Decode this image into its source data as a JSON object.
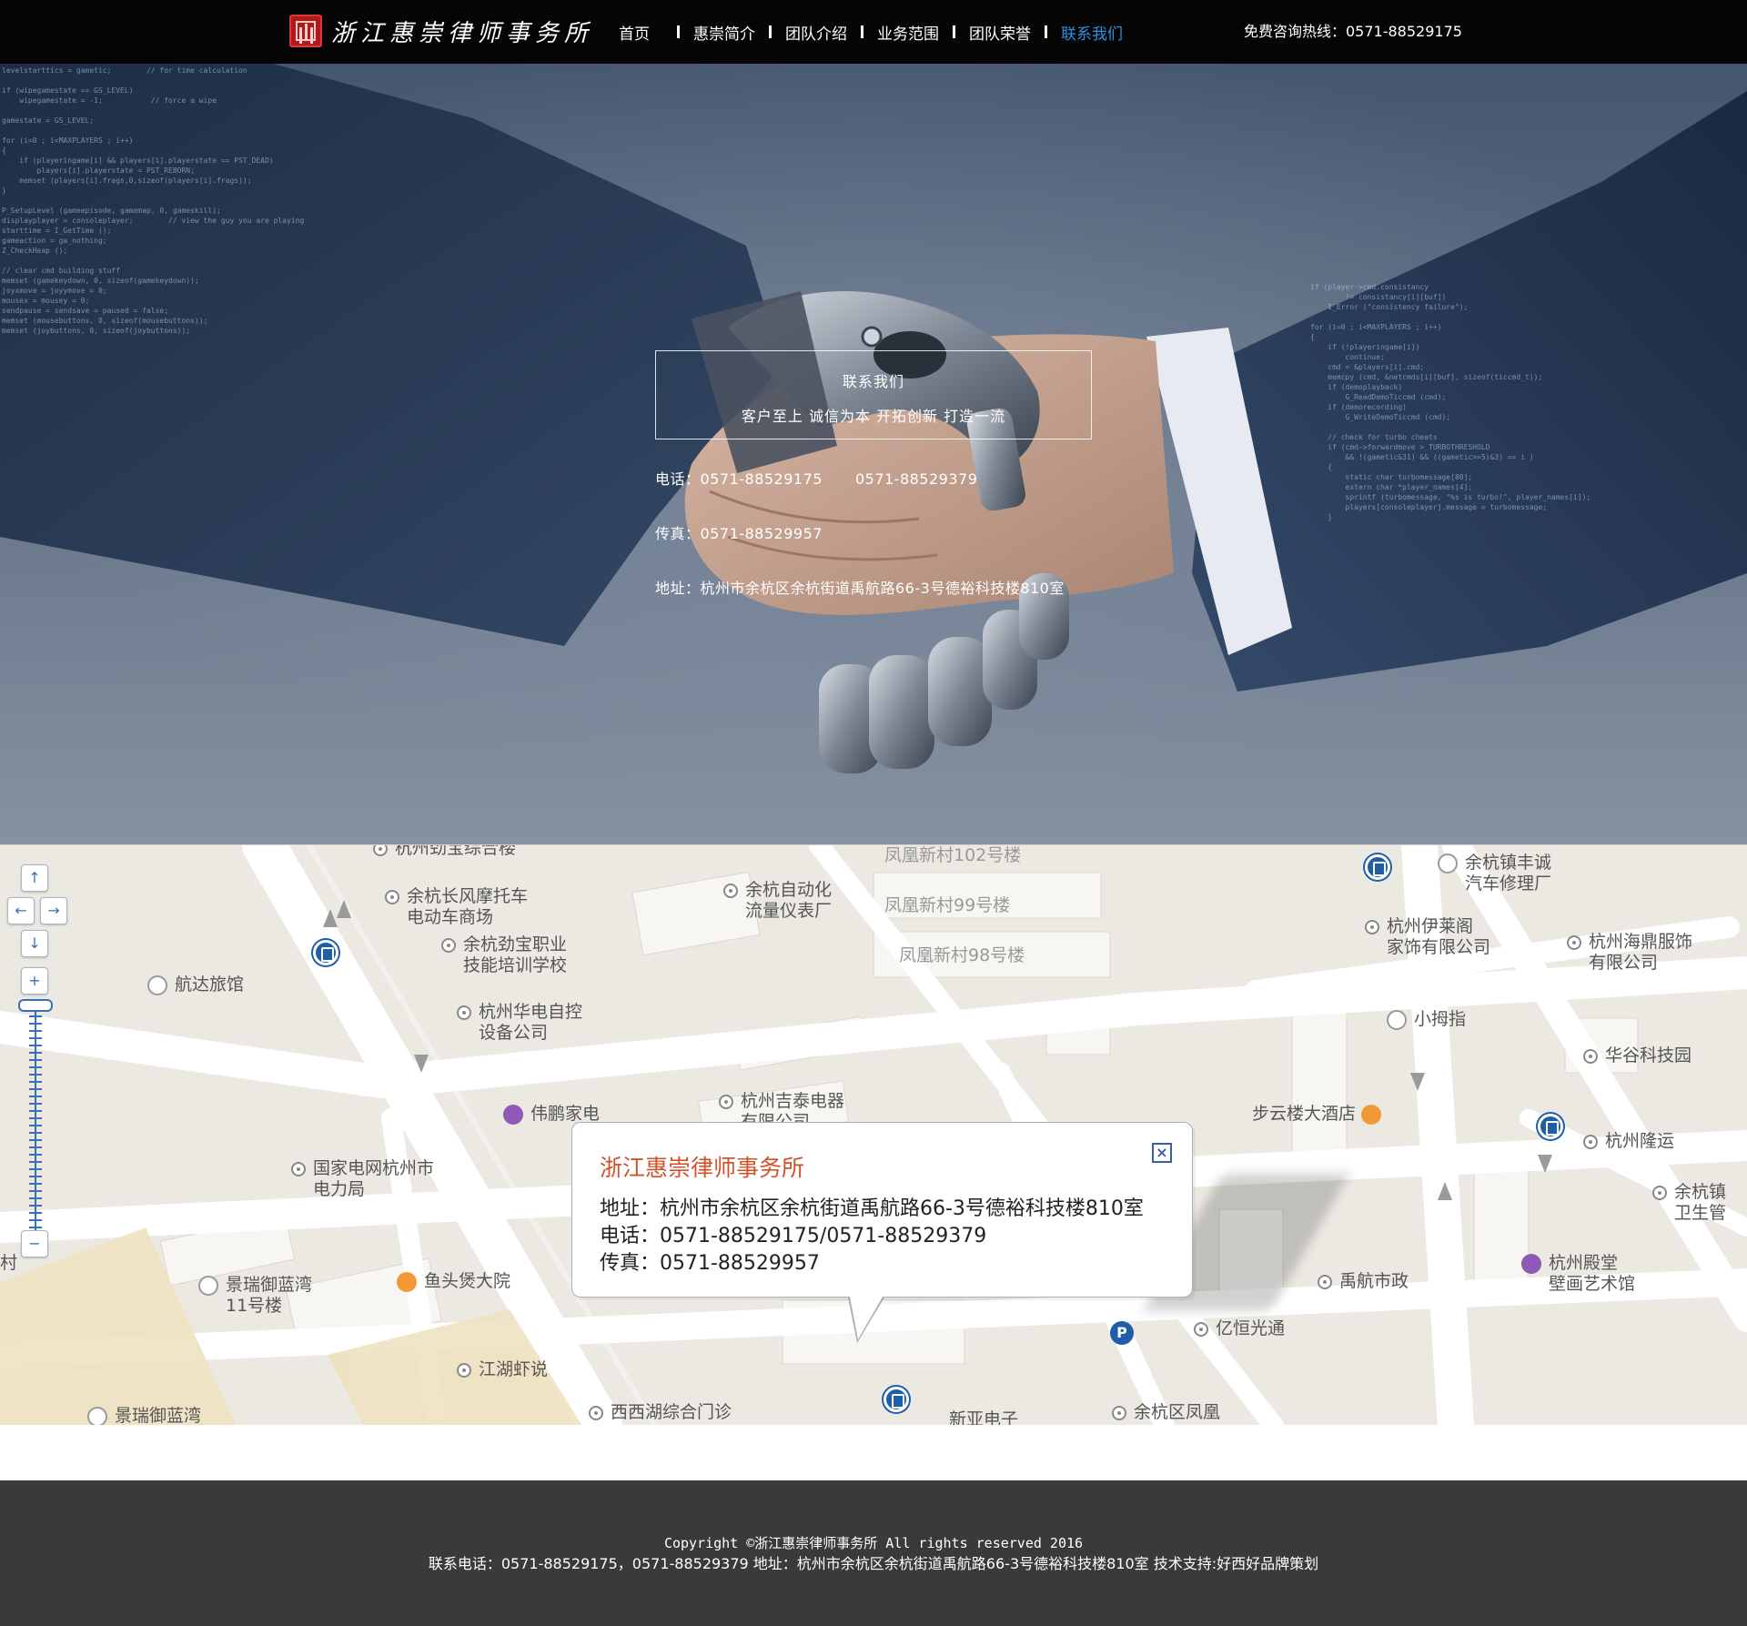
{
  "header": {
    "logo_text": "浙江惠崇律师事务所",
    "nav": [
      {
        "label": "首页"
      },
      {
        "label": "惠崇简介"
      },
      {
        "label": "团队介绍"
      },
      {
        "label": "业务范围"
      },
      {
        "label": "团队荣誉"
      },
      {
        "label": "联系我们"
      }
    ],
    "active_index": 5,
    "hotline": "免费咨询热线：0571-88529175"
  },
  "hero": {
    "title": "联系我们",
    "slogan": "客户至上  诚信为本  开拓创新  打造一流",
    "phone_label": "电话：",
    "phone_1": "0571-88529175",
    "phone_2": "0571-88529379",
    "fax": "传真：0571-88529957",
    "address": "地址：杭州市余杭区余杭街道禹航路66-3号德裕科技楼810室"
  },
  "map": {
    "controls": {
      "up": "↑",
      "left": "←",
      "right": "→",
      "down": "↓",
      "zoom_in": "+",
      "zoom_out": "−"
    },
    "pois": {
      "p1": "杭州劲宝综合楼",
      "p2": "凤凰新村102号楼",
      "p3_a": "余杭镇丰诚",
      "p3_b": "汽车修理厂",
      "p4_a": "余杭长风摩托车",
      "p4_b": "电动车商场",
      "p5_a": "余杭自动化",
      "p5_b": "流量仪表厂",
      "p6": "凤凰新村99号楼",
      "p7_a": "杭州伊莱阁",
      "p7_b": "家饰有限公司",
      "p8_a": "余杭劲宝职业",
      "p8_b": "技能培训学校",
      "p9": "凤凰新村98号楼",
      "p10_a": "杭州海鼎服饰",
      "p10_b": "有限公司",
      "p11": "航达旅馆",
      "p12_a": "杭州华电自控",
      "p12_b": "设备公司",
      "p13": "小拇指",
      "p14": "华谷科技园",
      "p15": "伟鹏家电",
      "p16_a": "杭州吉泰电器",
      "p16_b": "有限公司",
      "p17": "步云楼大酒店",
      "p18": "杭州隆运",
      "p19_a": "国家电网杭州市",
      "p19_b": "电力局",
      "p20_a": "余杭镇",
      "p20_b": "卫生管",
      "p21_a": "杭州殿堂",
      "p21_b": "壁画艺术馆",
      "p22": "禹航市政",
      "p23": "鱼头煲大院",
      "p24_a": "景瑞御蓝湾",
      "p24_b": "11号楼",
      "p25": "亿恒光通",
      "p26": "江湖虾说",
      "p27": "西西湖综合门诊",
      "p28": "景瑞御蓝湾",
      "p29": "新亚电子",
      "p30": "余杭区凤凰",
      "p31": "村"
    },
    "info_window": {
      "title": "浙江惠崇律师事务所",
      "close": "×",
      "address": "地址：杭州市余杭区余杭街道禹航路66-3号德裕科技楼810室",
      "phone": "电话：0571-88529175/0571-88529379",
      "fax": "传真：0571-88529957"
    }
  },
  "footer": {
    "copyright": "Copyright ©浙江惠崇律师事务所 All rights reserved 2016",
    "contact": "联系电话：0571-88529175，0571-88529379 地址：杭州市余杭区余杭街道禹航路66-3号德裕科技楼810室 技术支持:好西好品牌策划"
  }
}
